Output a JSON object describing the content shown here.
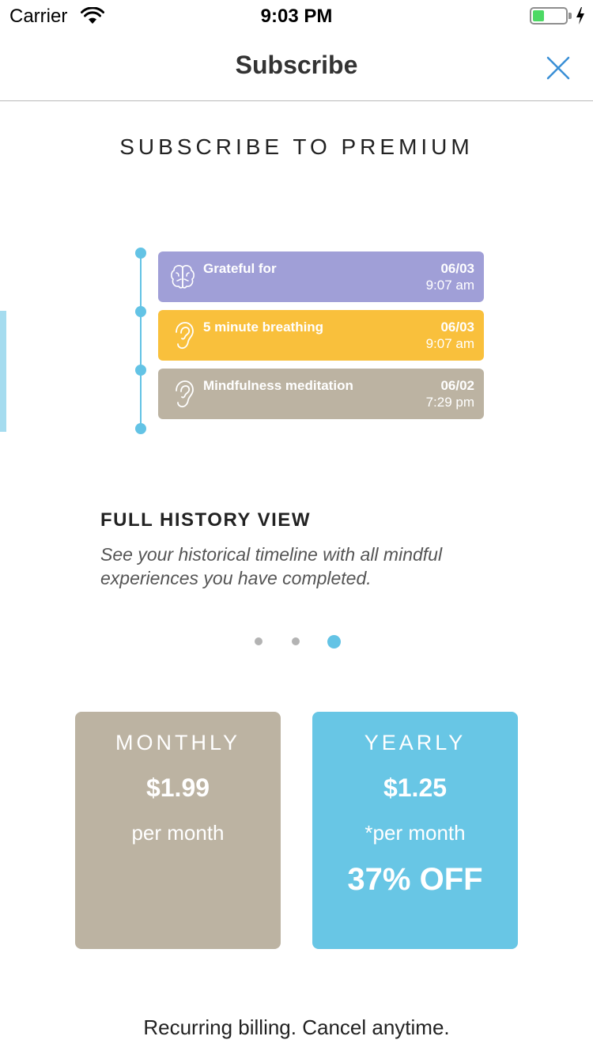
{
  "status_bar": {
    "carrier": "Carrier",
    "time": "9:03 PM",
    "battery_level": 0.35,
    "charging_icon": "bolt-icon"
  },
  "nav": {
    "title": "Subscribe",
    "close_icon": "close-icon"
  },
  "heading": "SUBSCRIBE TO PREMIUM",
  "timeline": {
    "events": [
      {
        "title": "Grateful for",
        "date": "06/03",
        "time": "9:07 am",
        "icon": "brain-icon",
        "color": "#a09fd7"
      },
      {
        "title": "5 minute breathing",
        "date": "06/03",
        "time": "9:07 am",
        "icon": "ear-icon",
        "color": "#f9c03c"
      },
      {
        "title": "Mindfulness meditation",
        "date": "06/02",
        "time": "7:29 pm",
        "icon": "ear-icon",
        "color": "#bcb3a2"
      }
    ],
    "accent_color": "#63c3e5"
  },
  "feature": {
    "title": "FULL HISTORY VIEW",
    "description": "See your historical timeline with all mindful experiences you have completed."
  },
  "pager": {
    "count": 3,
    "active": 2,
    "active_color": "#63c3e5",
    "inactive_color": "#b3b3b3"
  },
  "plans": {
    "monthly": {
      "name": "MONTHLY",
      "price": "$1.99",
      "period": "per month",
      "color": "#bcb3a2"
    },
    "yearly": {
      "name": "YEARLY",
      "price": "$1.25",
      "period": "*per month",
      "discount": "37% OFF",
      "color": "#68c6e5"
    }
  },
  "footer": "Recurring billing. Cancel anytime."
}
